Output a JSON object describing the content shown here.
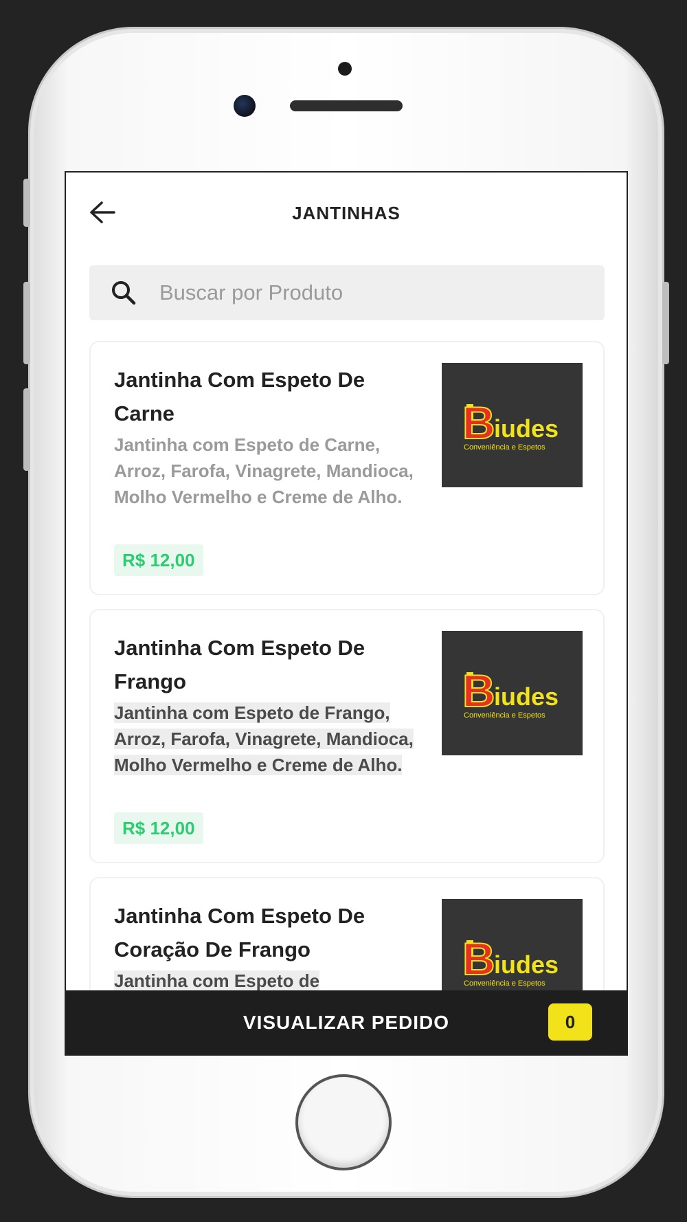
{
  "header": {
    "title": "JANTINHAS",
    "back_icon": "arrow-left-icon"
  },
  "search": {
    "placeholder": "Buscar por Produto",
    "value": "",
    "icon": "search-icon"
  },
  "products": [
    {
      "name": "Jantinha Com Espeto De Carne",
      "description": "Jantinha com Espeto de Carne, Arroz, Farofa, Vinagrete, Mandioca, Molho Vermelho e Creme de Alho.",
      "price": "R$ 12,00",
      "image_logo": {
        "initial": "B",
        "word": "iudes",
        "tagline": "Conveniência e Espetos"
      }
    },
    {
      "name": "Jantinha Com Espeto De Frango",
      "description": "Jantinha com Espeto de Frango, Arroz, Farofa, Vinagrete, Mandioca, Molho Vermelho e Creme de Alho.",
      "price": "R$ 12,00",
      "image_logo": {
        "initial": "B",
        "word": "iudes",
        "tagline": "Conveniência e Espetos"
      }
    },
    {
      "name": "Jantinha Com Espeto De Coração De Frango",
      "description": "Jantinha com Espeto de",
      "price": "",
      "image_logo": {
        "initial": "B",
        "word": "iudes",
        "tagline": "Conveniência e Espetos"
      }
    }
  ],
  "footer": {
    "label": "VISUALIZAR PEDIDO",
    "count": "0"
  },
  "colors": {
    "price_text": "#2ecc71",
    "price_bg": "#e8f8ee",
    "badge": "#f1e21a",
    "footer_bg": "#1e1e1e",
    "logo_red": "#e53025",
    "logo_yellow": "#f1e21a"
  }
}
